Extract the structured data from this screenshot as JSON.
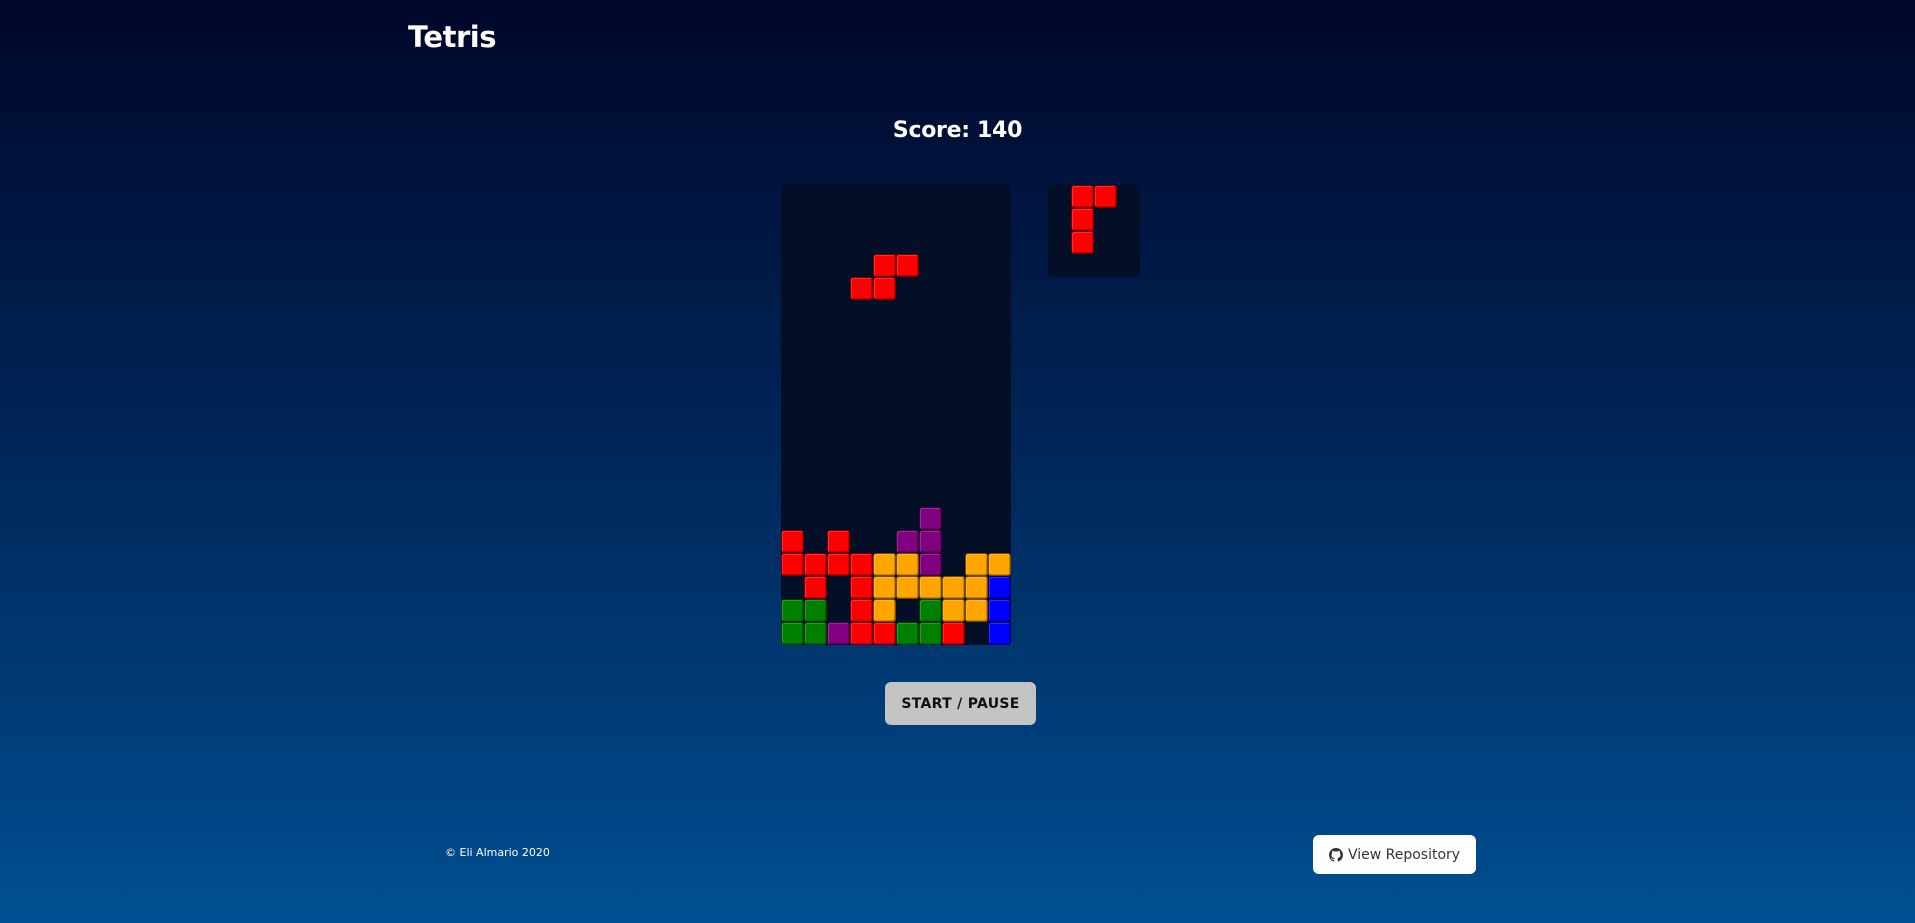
{
  "header": {
    "title": "Tetris"
  },
  "score": {
    "text": "Score: 140",
    "value": 140
  },
  "colors": {
    "R": "#ff0000",
    "O": "#ffa500",
    "P": "#800080",
    "G": "#008000",
    "B": "#0000ff"
  },
  "board": {
    "cols": 10,
    "rows": 20,
    "grid": [
      "..........",
      "..........",
      "..........",
      "....RR....",
      "...RR.....",
      "..........",
      "..........",
      "..........",
      "..........",
      "..........",
      "..........",
      "..........",
      "..........",
      "..........",
      "......P...",
      "R.R..PP...",
      "RRRROOP.OO",
      ".R.ROOOOOB",
      "GG.RO.GOOB",
      "GGPRRGGR.B"
    ]
  },
  "next_piece": {
    "label": "next-piece",
    "grid": [
      "RR..",
      "R...",
      "R...",
      "...."
    ]
  },
  "controls": {
    "start_pause_label": "START / PAUSE"
  },
  "footer": {
    "copyright": "© Eli Almario 2020",
    "repo_label": "View Repository",
    "repo_icon": "github-icon"
  }
}
